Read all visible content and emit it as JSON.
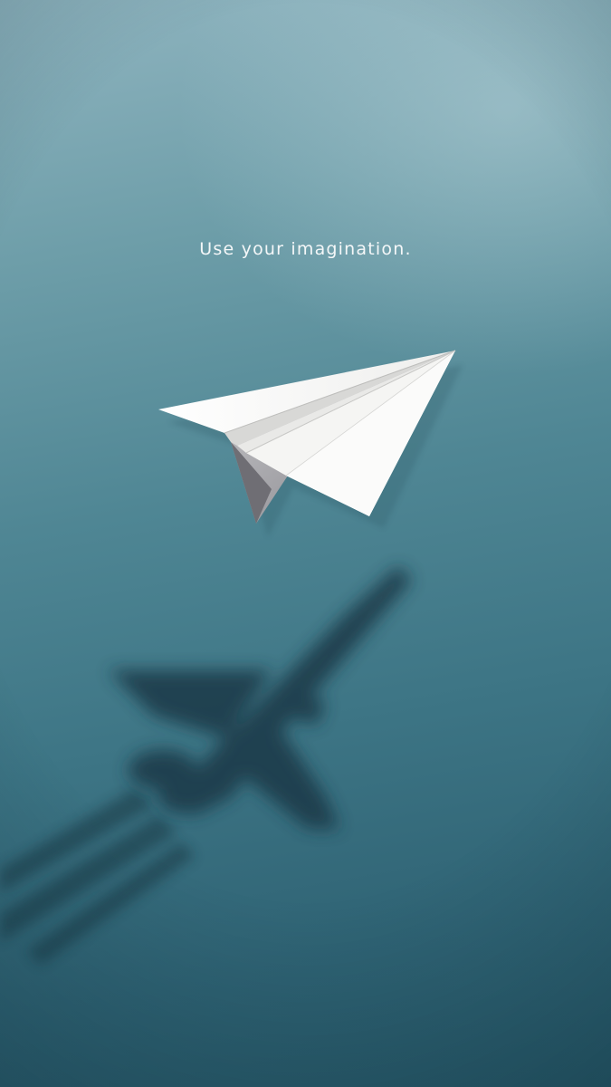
{
  "tagline": "Use your imagination.",
  "colors": {
    "sky_top": "#8fb4bf",
    "sky_bottom": "#275868",
    "paper": "#f4f4f2",
    "paper_shadow": "#8f8f94",
    "jet_shadow": "#1f3f4c"
  },
  "objects": {
    "paper_plane": "paper-plane",
    "jet_shadow": "fighter-jet-shadow"
  }
}
